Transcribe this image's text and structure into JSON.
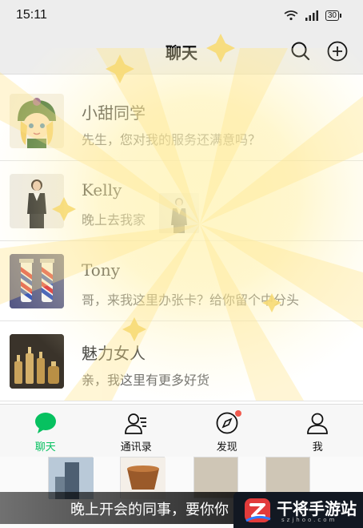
{
  "status_bar": {
    "time": "15:11",
    "battery": "30"
  },
  "header": {
    "title": "聊天"
  },
  "chats": [
    {
      "name": "小甜同学",
      "message": "先生，您对我的服务还满意吗？"
    },
    {
      "name": "Kelly",
      "message": "晚上去我家"
    },
    {
      "name": "Tony",
      "message": "哥，来我这里办张卡？给你留个中分头"
    },
    {
      "name": "魅力女人",
      "message": "亲，我这里有更多好货"
    }
  ],
  "tabs": [
    {
      "label": "聊天",
      "icon": "chat-bubble-icon",
      "active": true
    },
    {
      "label": "通讯录",
      "icon": "contacts-icon"
    },
    {
      "label": "发现",
      "icon": "compass-icon",
      "badge_dot": true
    },
    {
      "label": "我",
      "icon": "person-icon"
    }
  ],
  "caption": {
    "text": "晚上开会的同事，要你你"
  },
  "watermark": {
    "name": "干将手游站",
    "url": "szjhoo.com"
  },
  "colors": {
    "accent": "#07c160",
    "badge": "#f15b4f",
    "glow": "#fff3b0"
  }
}
